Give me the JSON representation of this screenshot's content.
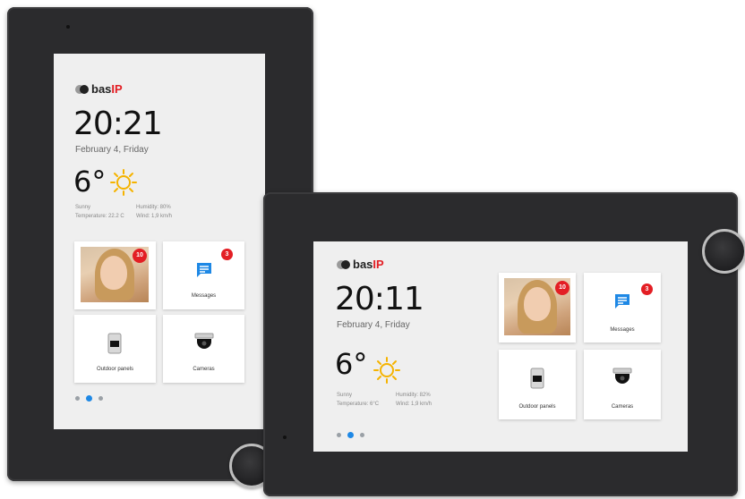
{
  "brand": {
    "name": "bas",
    "suffix": "IP"
  },
  "colors": {
    "accent": "#1e88e5",
    "badge": "#e31e24",
    "sun": "#f5b300"
  },
  "portrait": {
    "time": "20:21",
    "date": "February 4, Friday",
    "temperature": "6°",
    "weather": {
      "condition": "Sunny",
      "humidity": "Humidity: 80%",
      "temperature_detail": "Temperature: 22.2 C",
      "wind": "Wind: 1,9 km/h"
    },
    "tiles": {
      "intercom_badge": "10",
      "messages_label": "Messages",
      "messages_badge": "3",
      "outdoor_label": "Outdoor panels",
      "cameras_label": "Cameras"
    }
  },
  "landscape": {
    "time": "20:11",
    "date": "February 4, Friday",
    "temperature": "6°",
    "weather": {
      "condition": "Sunny",
      "humidity": "Humidity: 82%",
      "temperature_detail": "Temperature: 6°C",
      "wind": "Wind: 1,9 km/h"
    },
    "tiles": {
      "intercom_badge": "10",
      "messages_label": "Messages",
      "messages_badge": "3",
      "outdoor_label": "Outdoor panels",
      "cameras_label": "Cameras"
    }
  },
  "icons": [
    "sun-icon",
    "message-icon",
    "outdoor-panel-icon",
    "camera-icon"
  ]
}
